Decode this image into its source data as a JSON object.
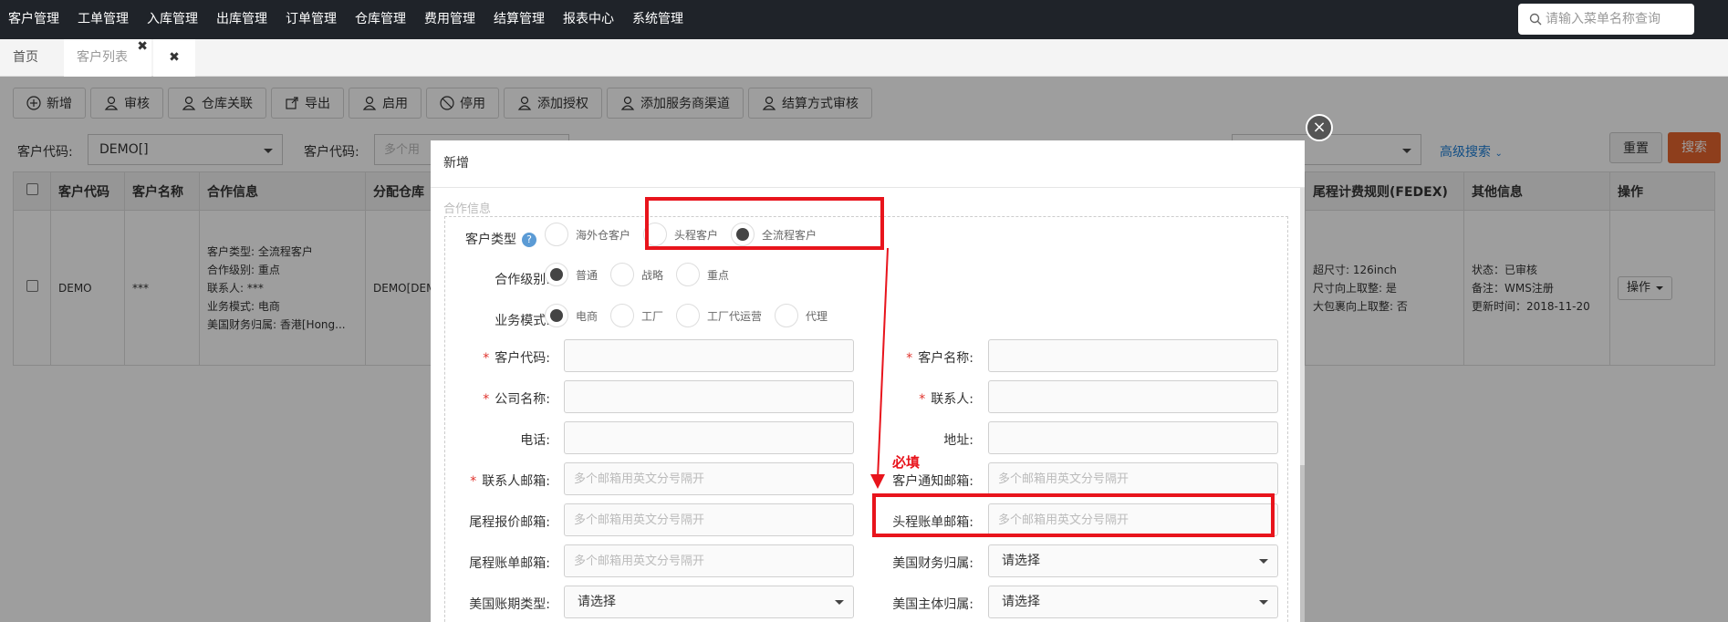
{
  "nav": {
    "items": [
      "客户管理",
      "工单管理",
      "入库管理",
      "出库管理",
      "订单管理",
      "仓库管理",
      "费用管理",
      "结算管理",
      "报表中心",
      "系统管理"
    ],
    "search_placeholder": "请输入菜单名称查询"
  },
  "tabs": {
    "home": "首页",
    "customers": "客户列表"
  },
  "toolbar": [
    "新增",
    "审核",
    "仓库关联",
    "导出",
    "启用",
    "停用",
    "添加授权",
    "添加服务商渠道",
    "结算方式审核"
  ],
  "filters": {
    "code_label": "客户代码:",
    "code_value": "DEMO[]",
    "code2_label": "客户代码:",
    "code2_placeholder": "多个用",
    "advanced": "高级搜索",
    "reset": "重置",
    "search": "搜索"
  },
  "table": {
    "headers": [
      "客户代码",
      "客户名称",
      "合作信息",
      "分配仓库",
      "尾程计费规则(FEDEX)",
      "其他信息",
      "操作"
    ],
    "row": {
      "code": "DEMO",
      "name": "***",
      "coop": [
        "客户类型: 全流程客户",
        "合作级别: 重点",
        "联系人: ***",
        "业务模式: 电商",
        "美国财务归属: 香港[Hong..."
      ],
      "warehouse": "DEMO[DEM",
      "fedex": [
        "超尺寸: 126inch",
        "尺寸向上取整: 是",
        "大包裹向上取整: 否"
      ],
      "other": [
        "状态：已审核",
        "备注：WMS注册",
        "更新时间：2018-11-20"
      ],
      "action": "操作"
    }
  },
  "modal": {
    "title": "新增",
    "section": "合作信息",
    "customer_type": {
      "label": "客户类型",
      "options": [
        "海外仓客户",
        "头程客户",
        "全流程客户"
      ],
      "selected": 2
    },
    "coop_level": {
      "label": "合作级别:",
      "options": [
        "普通",
        "战略",
        "重点"
      ],
      "selected": 0
    },
    "biz_mode": {
      "label": "业务模式:",
      "options": [
        "电商",
        "工厂",
        "工厂代运营",
        "代理"
      ],
      "selected": 0
    },
    "fields": {
      "customer_code": "客户代码:",
      "customer_name": "客户名称:",
      "company_name": "公司名称:",
      "contact": "联系人:",
      "phone": "电话:",
      "address": "地址:",
      "contact_email": "联系人邮箱:",
      "notify_email": "客户通知邮箱:",
      "quote_email": "尾程报价邮箱:",
      "first_bill_email": "头程账单邮箱:",
      "last_bill_email": "尾程账单邮箱:",
      "us_finance": "美国财务归属:",
      "us_period": "美国账期类型:",
      "us_entity": "美国主体归属:"
    },
    "email_placeholder": "多个邮箱用英文分号隔开",
    "select_placeholder": "请选择"
  },
  "annotation": {
    "required_note": "必填"
  }
}
